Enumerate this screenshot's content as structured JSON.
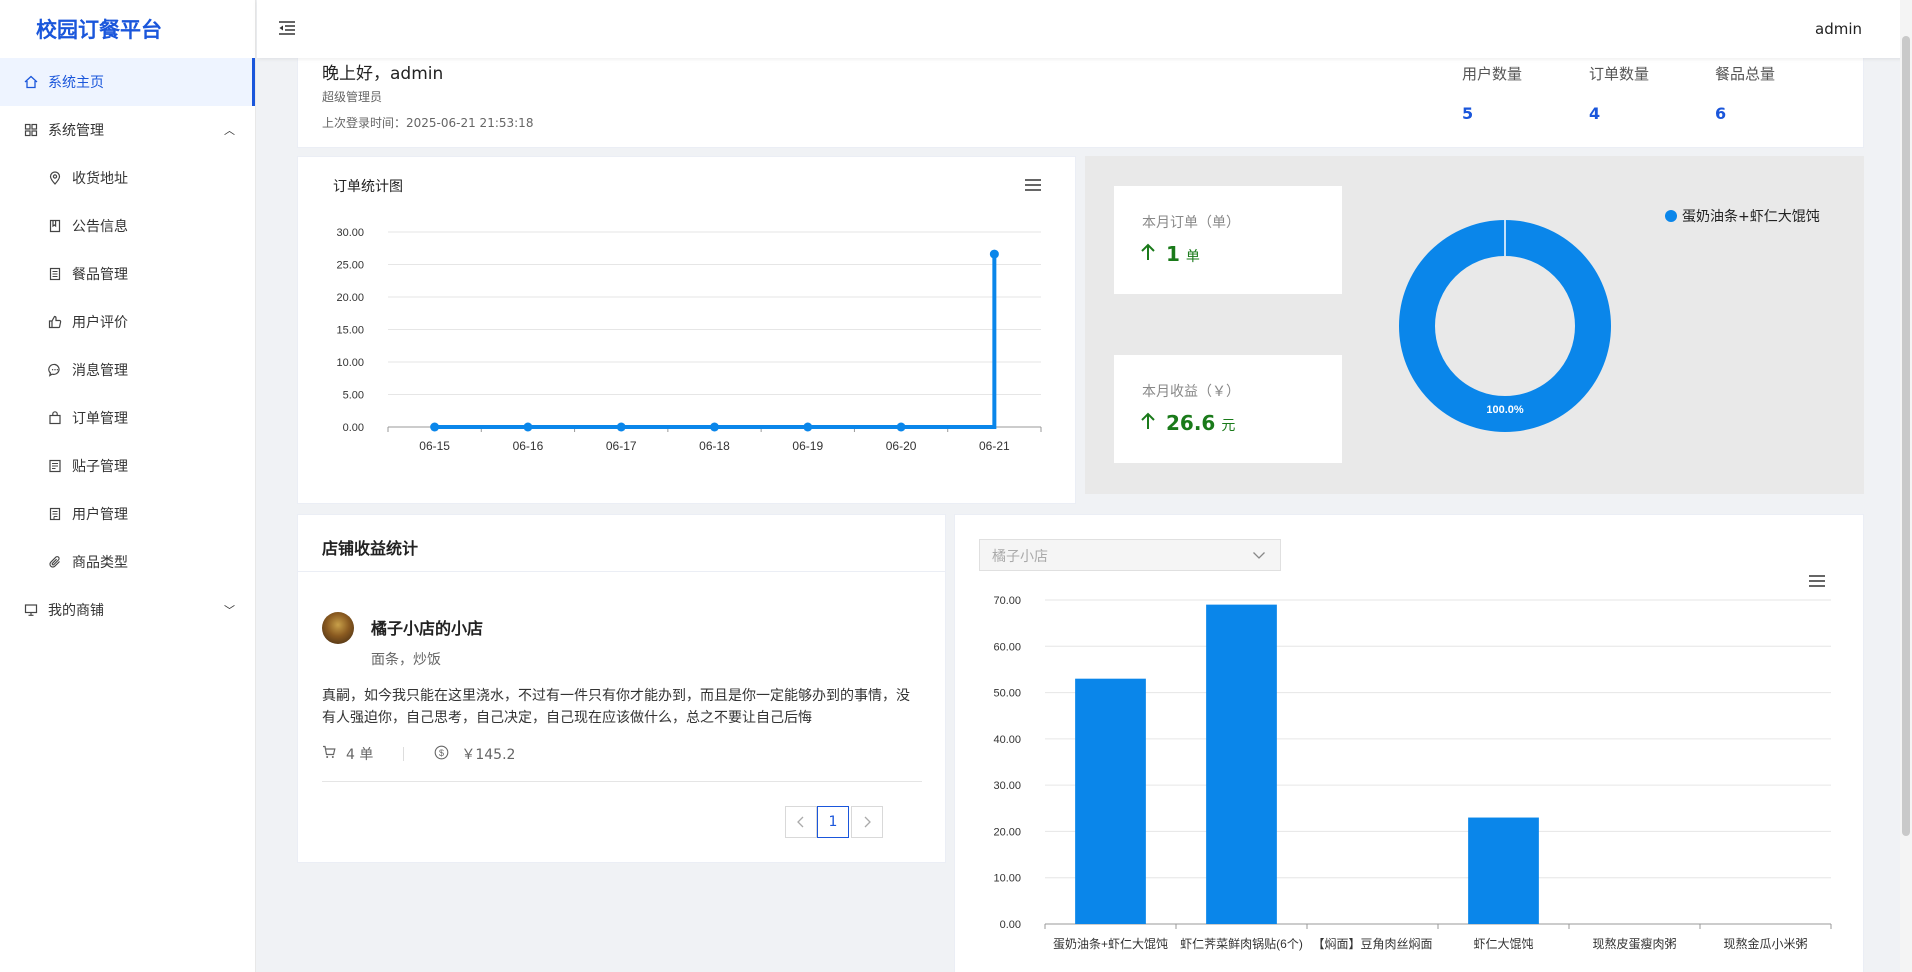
{
  "app": {
    "title": "校园订餐平台",
    "user": "admin"
  },
  "sidebar": {
    "items": [
      {
        "label": "系统主页",
        "icon": "home-icon"
      },
      {
        "label": "系统管理",
        "icon": "grid-icon"
      },
      {
        "label": "收货地址",
        "icon": "location-icon"
      },
      {
        "label": "公告信息",
        "icon": "notice-icon"
      },
      {
        "label": "餐品管理",
        "icon": "dish-icon"
      },
      {
        "label": "用户评价",
        "icon": "thumbs-up-icon"
      },
      {
        "label": "消息管理",
        "icon": "chat-icon"
      },
      {
        "label": "订单管理",
        "icon": "bag-icon"
      },
      {
        "label": "贴子管理",
        "icon": "post-icon"
      },
      {
        "label": "用户管理",
        "icon": "user-doc-icon"
      },
      {
        "label": "商品类型",
        "icon": "paperclip-icon"
      },
      {
        "label": "我的商铺",
        "icon": "monitor-icon"
      }
    ]
  },
  "welcome": {
    "greeting": "晚上好，admin",
    "role": "超级管理员",
    "last_login": "上次登录时间：2025-06-21 21:53:18",
    "stats": [
      {
        "label": "用户数量",
        "value": "5"
      },
      {
        "label": "订单数量",
        "value": "4"
      },
      {
        "label": "餐品总量",
        "value": "6"
      }
    ]
  },
  "order_chart": {
    "title": "订单统计图"
  },
  "monthly": {
    "orders_label": "本月订单（单）",
    "orders_value": "1",
    "orders_unit": "单",
    "revenue_label": "本月收益（￥）",
    "revenue_value": "26.6",
    "revenue_unit": "元"
  },
  "pie": {
    "legend": "蛋奶油条+虾仁大馄饨",
    "label": "100.0%"
  },
  "shop": {
    "section_title": "店铺收益统计",
    "name": "橘子小店的小店",
    "tags": "面条，炒饭",
    "desc": "真嗣，如今我只能在这里浇水，不过有一件只有你才能办到，而且是你一定能够办到的事情，没有人强迫你，自己思考，自己决定，自己现在应该做什么，总之不要让自己后悔",
    "orders": "4 单",
    "revenue": "￥145.2",
    "page": "1"
  },
  "bar_select": {
    "value": "橘子小店"
  },
  "colors": {
    "accent": "#1a56db",
    "series": "#0a86ea",
    "up": "#1a7a1a"
  },
  "chart_data": [
    {
      "type": "line",
      "title": "订单统计图",
      "x": [
        "06-15",
        "06-16",
        "06-17",
        "06-18",
        "06-19",
        "06-20",
        "06-21"
      ],
      "values": [
        0,
        0,
        0,
        0,
        0,
        0,
        26.6
      ],
      "yticks": [
        "0.00",
        "5.00",
        "10.00",
        "15.00",
        "20.00",
        "25.00",
        "30.00"
      ],
      "ylim": [
        0,
        30
      ],
      "grid": true
    },
    {
      "type": "pie",
      "slices": [
        {
          "name": "蛋奶油条+虾仁大馄饨",
          "value": 100.0
        }
      ],
      "legend": "top-right"
    },
    {
      "type": "bar",
      "categories": [
        "蛋奶油条+虾仁大馄饨",
        "虾仁荠菜鲜肉锅贴(6个)",
        "【焖面】豆角肉丝焖面",
        "虾仁大馄饨",
        "现熬皮蛋瘦肉粥",
        "现熬金瓜小米粥"
      ],
      "values": [
        53,
        69,
        0,
        23,
        0,
        0
      ],
      "yticks": [
        "0.00",
        "10.00",
        "20.00",
        "30.00",
        "40.00",
        "50.00",
        "60.00",
        "70.00"
      ],
      "ylim": [
        0,
        70
      ],
      "grid": true
    }
  ]
}
